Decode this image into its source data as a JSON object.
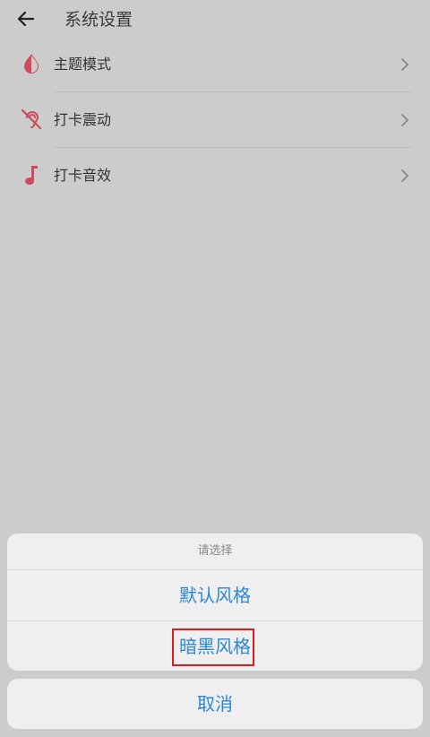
{
  "header": {
    "title": "系统设置",
    "back_icon": "arrow-left-icon"
  },
  "settings": [
    {
      "label": "主题模式",
      "icon": "drop-icon"
    },
    {
      "label": "打卡震动",
      "icon": "ear-off-icon"
    },
    {
      "label": "打卡音效",
      "icon": "music-note-icon"
    }
  ],
  "sheet": {
    "title": "请选择",
    "options": [
      "默认风格",
      "暗黑风格"
    ],
    "highlighted_option": "暗黑风格",
    "cancel_label": "取消"
  },
  "colors": {
    "accent": "#2b86d8",
    "icon": "#cf4a5a",
    "highlight_border": "#e01b1b",
    "overlay": "#cccccc"
  }
}
